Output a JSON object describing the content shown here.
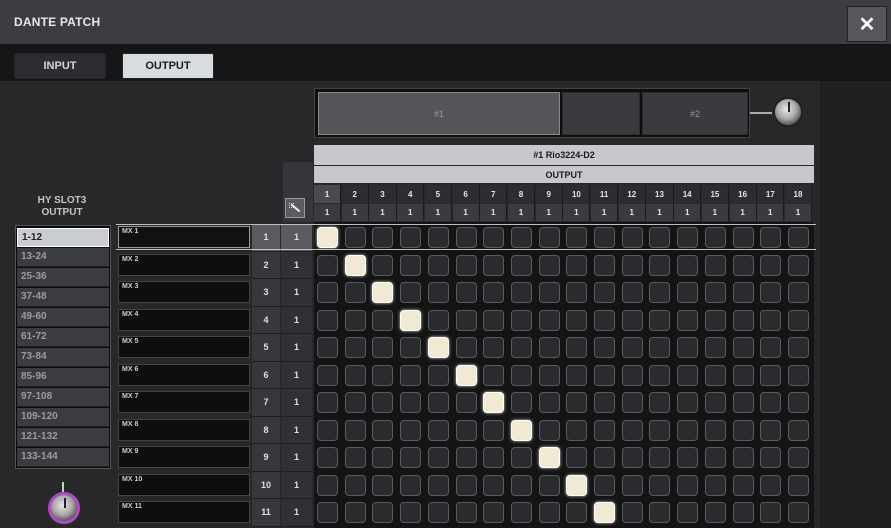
{
  "window": {
    "title": "DANTE PATCH",
    "close_icon": "close-icon"
  },
  "tabs": [
    {
      "label": "INPUT",
      "active": false
    },
    {
      "label": "OUTPUT",
      "active": true
    }
  ],
  "bank_selector": {
    "banks": [
      "#1",
      "",
      "#2"
    ],
    "selected_bank": 0
  },
  "device": {
    "name": "#1 Rio3224-D2",
    "section": "OUTPUT"
  },
  "columns": [
    {
      "num": "1",
      "sub": "1"
    },
    {
      "num": "2",
      "sub": "1"
    },
    {
      "num": "3",
      "sub": "1"
    },
    {
      "num": "4",
      "sub": "1"
    },
    {
      "num": "5",
      "sub": "1"
    },
    {
      "num": "6",
      "sub": "1"
    },
    {
      "num": "7",
      "sub": "1"
    },
    {
      "num": "8",
      "sub": "1"
    },
    {
      "num": "9",
      "sub": "1"
    },
    {
      "num": "10",
      "sub": "1"
    },
    {
      "num": "11",
      "sub": "1"
    },
    {
      "num": "12",
      "sub": "1"
    },
    {
      "num": "13",
      "sub": "1"
    },
    {
      "num": "14",
      "sub": "1"
    },
    {
      "num": "15",
      "sub": "1"
    },
    {
      "num": "16",
      "sub": "1"
    },
    {
      "num": "17",
      "sub": "1"
    },
    {
      "num": "18",
      "sub": "1"
    }
  ],
  "slot_panel": {
    "title_line1": "HY SLOT3",
    "title_line2": "OUTPUT",
    "ranges": [
      "1-12",
      "13-24",
      "25-36",
      "37-48",
      "49-60",
      "61-72",
      "73-84",
      "85-96",
      "97-108",
      "109-120",
      "121-132",
      "133-144"
    ],
    "selected_index": 0
  },
  "rows": [
    {
      "name": "MX 1",
      "num": "1",
      "sub": "1",
      "patched_col": 1
    },
    {
      "name": "MX 2",
      "num": "2",
      "sub": "1",
      "patched_col": 2
    },
    {
      "name": "MX 3",
      "num": "3",
      "sub": "1",
      "patched_col": 3
    },
    {
      "name": "MX 4",
      "num": "4",
      "sub": "1",
      "patched_col": 4
    },
    {
      "name": "MX 5",
      "num": "5",
      "sub": "1",
      "patched_col": 5
    },
    {
      "name": "MX 6",
      "num": "6",
      "sub": "1",
      "patched_col": 6
    },
    {
      "name": "MX 7",
      "num": "7",
      "sub": "1",
      "patched_col": 7
    },
    {
      "name": "MX 8",
      "num": "8",
      "sub": "1",
      "patched_col": 8
    },
    {
      "name": "MX 9",
      "num": "9",
      "sub": "1",
      "patched_col": 9
    },
    {
      "name": "MX 10",
      "num": "10",
      "sub": "1",
      "patched_col": 10
    },
    {
      "name": "MX 11",
      "num": "11",
      "sub": "1",
      "patched_col": 11
    }
  ],
  "selected_row": 0,
  "colors": {
    "patched_cell": "#f1e9d2",
    "empty_cell": "#2a2b2e",
    "knob_ring": "#b048c8"
  }
}
